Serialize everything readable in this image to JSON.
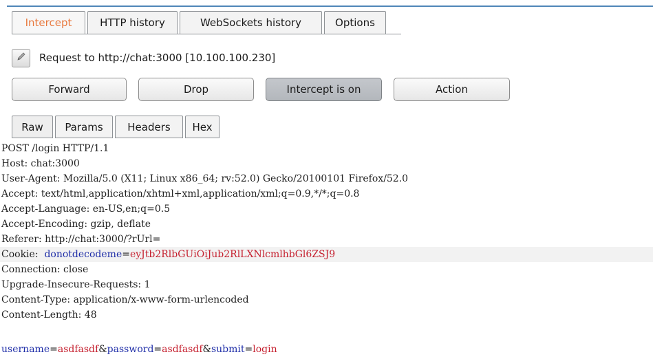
{
  "main_tabs": [
    {
      "label": "Intercept",
      "active": true
    },
    {
      "label": "HTTP history",
      "active": false
    },
    {
      "label": "WebSockets history",
      "active": false
    },
    {
      "label": "Options",
      "active": false
    }
  ],
  "request_label": "Request to http://chat:3000  [10.100.100.230]",
  "buttons": {
    "forward": "Forward",
    "drop": "Drop",
    "intercept": "Intercept is on",
    "action": "Action"
  },
  "sub_tabs": [
    {
      "label": "Raw",
      "active": true
    },
    {
      "label": "Params",
      "active": false
    },
    {
      "label": "Headers",
      "active": false
    },
    {
      "label": "Hex",
      "active": false
    }
  ],
  "raw_lines": [
    "POST /login HTTP/1.1",
    "Host: chat:3000",
    "User-Agent: Mozilla/5.0 (X11; Linux x86_64; rv:52.0) Gecko/20100101 Firefox/52.0",
    "Accept: text/html,application/xhtml+xml,application/xml;q=0.9,*/*;q=0.8",
    "Accept-Language: en-US,en;q=0.5",
    "Accept-Encoding: gzip, deflate",
    "Referer: http://chat:3000/?rUrl=",
    "",
    "Connection: close",
    "Upgrade-Insecure-Requests: 1",
    "Content-Type: application/x-www-form-urlencoded",
    "Content-Length: 48",
    "",
    ""
  ],
  "cookie": {
    "prefix": "Cookie:  ",
    "name": "donotdecodeme",
    "eq": "=",
    "value": "eyJtb2RlbGUiOiJub2RlLXNlcmlhbGl6ZSJ9"
  },
  "body": {
    "k1": "username",
    "v1": "asdfasdf",
    "k2": "password",
    "v2": "asdfasdf",
    "k3": "submit",
    "v3": "login"
  },
  "colors": {
    "accent_tab": "#e8783d",
    "param_name": "#1f2ea8",
    "param_value": "#c51f2e"
  }
}
